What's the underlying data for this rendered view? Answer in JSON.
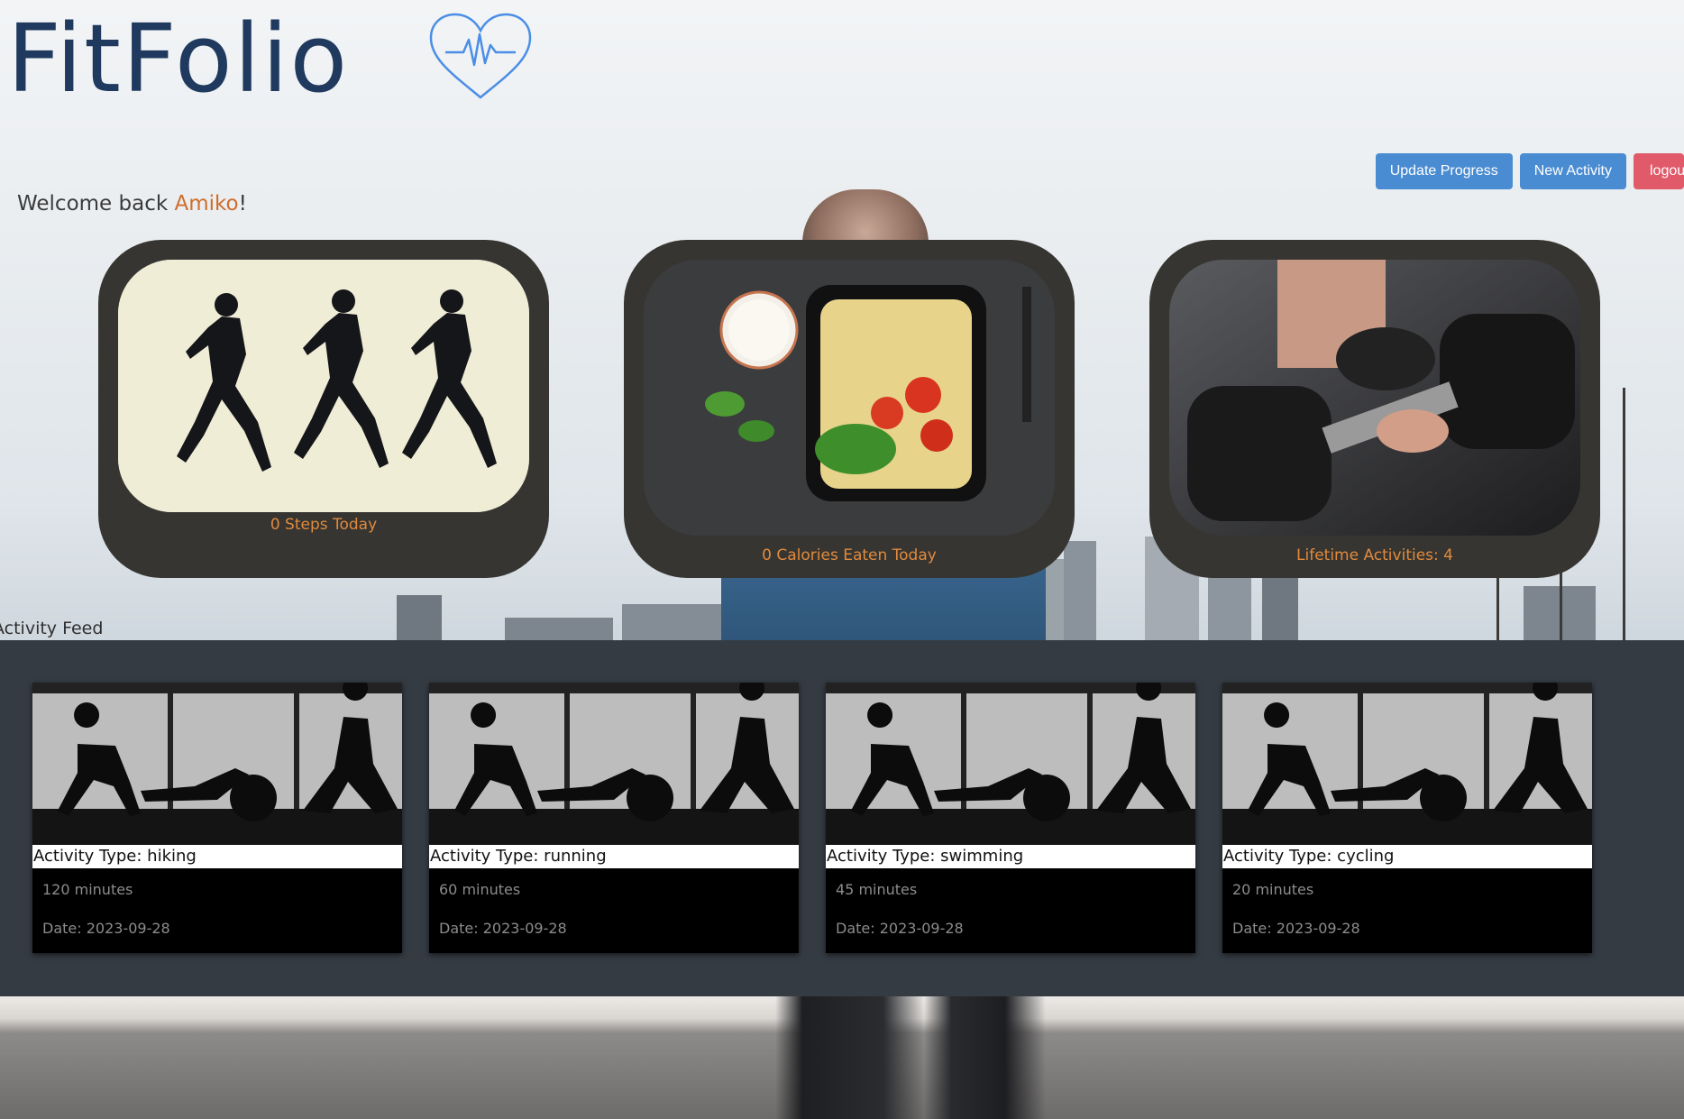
{
  "app": {
    "logo_text": "FitFolio"
  },
  "toolbar": {
    "update_progress_label": "Update Progress",
    "new_activity_label": "New Activity",
    "logout_label": "logout"
  },
  "welcome": {
    "prefix": "Welcome back ",
    "name": "Amiko",
    "suffix": "!"
  },
  "stats": [
    {
      "label": "0 Steps Today",
      "image": "running-figures"
    },
    {
      "label": "0 Calories Eaten Today",
      "image": "pasta-salad-bowl"
    },
    {
      "label": "Lifetime Activities: 4",
      "image": "dumbbell"
    }
  ],
  "feed": {
    "title": "Activity Feed",
    "items": [
      {
        "type": "Activity Type: hiking",
        "minutes": "120 minutes",
        "date": "Date: 2023-09-28"
      },
      {
        "type": "Activity Type: running",
        "minutes": "60 minutes",
        "date": "Date: 2023-09-28"
      },
      {
        "type": "Activity Type: swimming",
        "minutes": "45 minutes",
        "date": "Date: 2023-09-28"
      },
      {
        "type": "Activity Type: cycling",
        "minutes": "20 minutes",
        "date": "Date: 2023-09-28"
      }
    ]
  },
  "colors": {
    "logo": "#1f3a5e",
    "accent_orange": "#cf6d2b",
    "button_blue": "#4a8cd2",
    "button_red": "#e05a6a",
    "card_dark": "#363531",
    "feed_panel": "#353b43"
  },
  "icons": [
    "heart-pulse-icon"
  ]
}
